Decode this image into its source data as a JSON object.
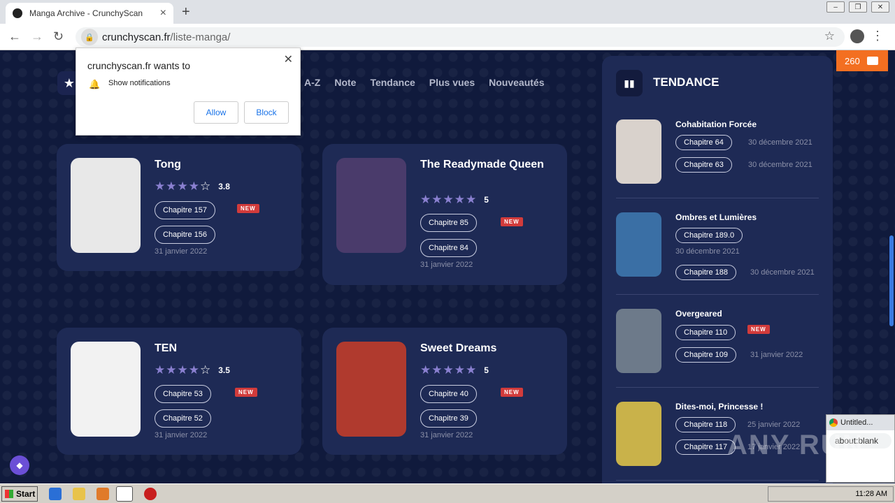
{
  "browser": {
    "tab_title": "Manga Archive - CrunchyScan",
    "url_domain": "crunchyscan.fr",
    "url_path": "/liste-manga/"
  },
  "popup": {
    "title": "crunchyscan.fr wants to",
    "text": "Show notifications",
    "allow": "Allow",
    "block": "Block"
  },
  "filters": [
    "A-Z",
    "Note",
    "Tendance",
    "Plus vues",
    "Nouveautés"
  ],
  "cards": [
    {
      "title": "Tong",
      "rating": 3.8,
      "rating_text": "3.8",
      "ch1": "Chapitre 157",
      "ch2": "Chapitre 156",
      "date": "31 janvier 2022",
      "new": "NEW",
      "cover_color": "#e8e8e8"
    },
    {
      "title": "The Readymade Queen",
      "rating": 5,
      "rating_text": "5",
      "ch1": "Chapitre 85",
      "ch2": "Chapitre 84",
      "date": "31 janvier 2022",
      "new": "NEW",
      "cover_color": "#4a3b6b"
    },
    {
      "title": "TEN",
      "rating": 3.5,
      "rating_text": "3.5",
      "ch1": "Chapitre 53",
      "ch2": "Chapitre 52",
      "date": "31 janvier 2022",
      "new": "NEW",
      "cover_color": "#f2f2f2"
    },
    {
      "title": "Sweet Dreams",
      "rating": 5,
      "rating_text": "5",
      "ch1": "Chapitre 40",
      "ch2": "Chapitre 39",
      "date": "31 janvier 2022",
      "new": "NEW",
      "cover_color": "#b03a2e"
    }
  ],
  "sidebar": {
    "title": "TENDANCE",
    "items": [
      {
        "name": "Cohabitation Forcée",
        "c1": "Chapitre 64",
        "d1": "30 décembre 2021",
        "c2": "Chapitre 63",
        "d2": "30 décembre 2021",
        "thumb": "#d9d2cc"
      },
      {
        "name": "Ombres et Lumières",
        "c1": "Chapitre 189.0",
        "d1": "30 décembre 2021",
        "c2": "Chapitre 188",
        "d2": "30 décembre 2021",
        "thumb": "#3a6fa5"
      },
      {
        "name": "Overgeared",
        "c1": "Chapitre 110",
        "d1": "NEW",
        "c2": "Chapitre 109",
        "d2": "31 janvier 2022",
        "thumb": "#6d7a8a"
      },
      {
        "name": "Dites-moi, Princesse !",
        "c1": "Chapitre 118",
        "d1": "25 janvier 2022",
        "c2": "Chapitre 117",
        "d2": "17 janvier 2022",
        "thumb": "#c9b24a"
      }
    ]
  },
  "comments_count": "260",
  "mini_window": {
    "tab": "Untitled...",
    "url": "about:blank"
  },
  "watermark": "ANY RUN",
  "taskbar": {
    "start": "Start",
    "time": "11:28 AM"
  }
}
